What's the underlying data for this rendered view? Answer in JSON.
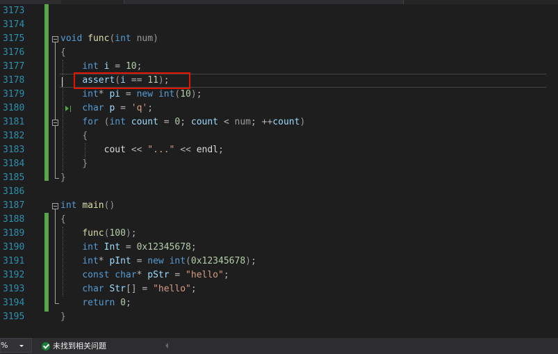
{
  "editor": {
    "lines": [
      {
        "n": "3173",
        "tokens": []
      },
      {
        "n": "3174",
        "tokens": []
      },
      {
        "n": "3175",
        "tokens": [
          {
            "c": "kw",
            "t": "void"
          },
          {
            "c": "txt",
            "t": " "
          },
          {
            "c": "fn",
            "t": "func"
          },
          {
            "c": "par",
            "t": "("
          },
          {
            "c": "kw",
            "t": "int"
          },
          {
            "c": "txt",
            "t": " "
          },
          {
            "c": "par",
            "t": "num)"
          }
        ]
      },
      {
        "n": "3176",
        "tokens": [
          {
            "c": "par",
            "t": "{"
          }
        ]
      },
      {
        "n": "3177",
        "tokens": [
          {
            "c": "txt",
            "t": "    "
          },
          {
            "c": "kw",
            "t": "int"
          },
          {
            "c": "txt",
            "t": " "
          },
          {
            "c": "var",
            "t": "i"
          },
          {
            "c": "op",
            "t": " = "
          },
          {
            "c": "num",
            "t": "10"
          },
          {
            "c": "op",
            "t": ";"
          }
        ]
      },
      {
        "n": "3178",
        "tokens": [
          {
            "c": "txt",
            "t": "    "
          },
          {
            "c": "var",
            "t": "assert"
          },
          {
            "c": "par",
            "t": "("
          },
          {
            "c": "var",
            "t": "i"
          },
          {
            "c": "op",
            "t": " == "
          },
          {
            "c": "num",
            "t": "11"
          },
          {
            "c": "par",
            "t": ")"
          },
          {
            "c": "op",
            "t": ";"
          }
        ]
      },
      {
        "n": "3179",
        "tokens": [
          {
            "c": "txt",
            "t": "    "
          },
          {
            "c": "kw",
            "t": "int"
          },
          {
            "c": "op",
            "t": "* "
          },
          {
            "c": "var",
            "t": "pi"
          },
          {
            "c": "op",
            "t": " = "
          },
          {
            "c": "kw",
            "t": "new"
          },
          {
            "c": "txt",
            "t": " "
          },
          {
            "c": "kw",
            "t": "int"
          },
          {
            "c": "par",
            "t": "("
          },
          {
            "c": "num",
            "t": "10"
          },
          {
            "c": "par",
            "t": ")"
          },
          {
            "c": "op",
            "t": ";"
          }
        ]
      },
      {
        "n": "3180",
        "tokens": [
          {
            "c": "txt",
            "t": "    "
          },
          {
            "c": "kw",
            "t": "char"
          },
          {
            "c": "txt",
            "t": " "
          },
          {
            "c": "var",
            "t": "p"
          },
          {
            "c": "op",
            "t": " = "
          },
          {
            "c": "str",
            "t": "'q'"
          },
          {
            "c": "op",
            "t": ";"
          }
        ]
      },
      {
        "n": "3181",
        "tokens": [
          {
            "c": "txt",
            "t": "    "
          },
          {
            "c": "kw",
            "t": "for"
          },
          {
            "c": "txt",
            "t": " "
          },
          {
            "c": "par",
            "t": "("
          },
          {
            "c": "kw",
            "t": "int"
          },
          {
            "c": "txt",
            "t": " "
          },
          {
            "c": "var",
            "t": "count"
          },
          {
            "c": "op",
            "t": " = "
          },
          {
            "c": "num",
            "t": "0"
          },
          {
            "c": "op",
            "t": "; "
          },
          {
            "c": "var",
            "t": "count"
          },
          {
            "c": "op",
            "t": " < "
          },
          {
            "c": "par",
            "t": "num"
          },
          {
            "c": "op",
            "t": "; ++"
          },
          {
            "c": "var",
            "t": "count"
          },
          {
            "c": "par",
            "t": ")"
          }
        ]
      },
      {
        "n": "3182",
        "tokens": [
          {
            "c": "txt",
            "t": "    "
          },
          {
            "c": "par",
            "t": "{"
          }
        ]
      },
      {
        "n": "3183",
        "tokens": [
          {
            "c": "txt",
            "t": "        "
          },
          {
            "c": "txt",
            "t": "cout"
          },
          {
            "c": "op",
            "t": " << "
          },
          {
            "c": "str",
            "t": "\"...\""
          },
          {
            "c": "op",
            "t": " << "
          },
          {
            "c": "txt",
            "t": "endl"
          },
          {
            "c": "op",
            "t": ";"
          }
        ]
      },
      {
        "n": "3184",
        "tokens": [
          {
            "c": "txt",
            "t": "    "
          },
          {
            "c": "par",
            "t": "}"
          }
        ]
      },
      {
        "n": "3185",
        "tokens": [
          {
            "c": "par",
            "t": "}"
          }
        ]
      },
      {
        "n": "3186",
        "tokens": []
      },
      {
        "n": "3187",
        "tokens": [
          {
            "c": "kw",
            "t": "int"
          },
          {
            "c": "txt",
            "t": " "
          },
          {
            "c": "fn",
            "t": "main"
          },
          {
            "c": "par",
            "t": "()"
          }
        ]
      },
      {
        "n": "3188",
        "tokens": [
          {
            "c": "par",
            "t": "{"
          }
        ]
      },
      {
        "n": "3189",
        "tokens": [
          {
            "c": "txt",
            "t": "    "
          },
          {
            "c": "fn",
            "t": "func"
          },
          {
            "c": "par",
            "t": "("
          },
          {
            "c": "num",
            "t": "100"
          },
          {
            "c": "par",
            "t": ")"
          },
          {
            "c": "op",
            "t": ";"
          }
        ]
      },
      {
        "n": "3190",
        "tokens": [
          {
            "c": "txt",
            "t": "    "
          },
          {
            "c": "kw",
            "t": "int"
          },
          {
            "c": "txt",
            "t": " "
          },
          {
            "c": "var",
            "t": "Int"
          },
          {
            "c": "op",
            "t": " = "
          },
          {
            "c": "num",
            "t": "0x12345678"
          },
          {
            "c": "op",
            "t": ";"
          }
        ]
      },
      {
        "n": "3191",
        "tokens": [
          {
            "c": "txt",
            "t": "    "
          },
          {
            "c": "kw",
            "t": "int"
          },
          {
            "c": "op",
            "t": "* "
          },
          {
            "c": "var",
            "t": "pInt"
          },
          {
            "c": "op",
            "t": " = "
          },
          {
            "c": "kw",
            "t": "new"
          },
          {
            "c": "txt",
            "t": " "
          },
          {
            "c": "kw",
            "t": "int"
          },
          {
            "c": "par",
            "t": "("
          },
          {
            "c": "num",
            "t": "0x12345678"
          },
          {
            "c": "par",
            "t": ")"
          },
          {
            "c": "op",
            "t": ";"
          }
        ]
      },
      {
        "n": "3192",
        "tokens": [
          {
            "c": "txt",
            "t": "    "
          },
          {
            "c": "kw",
            "t": "const"
          },
          {
            "c": "txt",
            "t": " "
          },
          {
            "c": "kw",
            "t": "char"
          },
          {
            "c": "op",
            "t": "* "
          },
          {
            "c": "var",
            "t": "pStr"
          },
          {
            "c": "op",
            "t": " = "
          },
          {
            "c": "str",
            "t": "\"hello\""
          },
          {
            "c": "op",
            "t": ";"
          }
        ]
      },
      {
        "n": "3193",
        "tokens": [
          {
            "c": "txt",
            "t": "    "
          },
          {
            "c": "kw",
            "t": "char"
          },
          {
            "c": "txt",
            "t": " "
          },
          {
            "c": "var",
            "t": "Str"
          },
          {
            "c": "op",
            "t": "[] = "
          },
          {
            "c": "str",
            "t": "\"hello\""
          },
          {
            "c": "op",
            "t": ";"
          }
        ]
      },
      {
        "n": "3194",
        "tokens": [
          {
            "c": "txt",
            "t": "    "
          },
          {
            "c": "kw",
            "t": "return"
          },
          {
            "c": "txt",
            "t": " "
          },
          {
            "c": "num",
            "t": "0"
          },
          {
            "c": "op",
            "t": ";"
          }
        ]
      },
      {
        "n": "3195",
        "tokens": [
          {
            "c": "par",
            "t": "}"
          }
        ]
      }
    ],
    "colors": {
      "keyword": "#569cd6",
      "function": "#dcdcaa",
      "variable": "#9cdcfe",
      "number": "#b5cea8",
      "string": "#d69d85",
      "line_number": "#2b91af",
      "change_bar": "#57a64a",
      "highlight_box": "#e51400"
    }
  },
  "statusbar": {
    "zoom": "%",
    "issues_text": "未找到相关问题",
    "issues_icon": "check-circle-icon"
  }
}
